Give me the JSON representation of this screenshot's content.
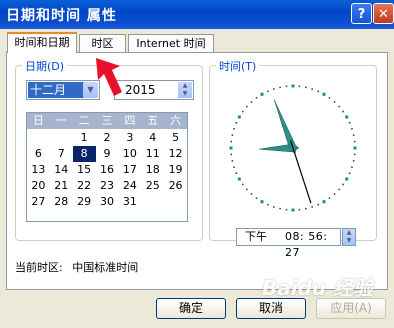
{
  "window": {
    "title": "日期和时间 属性",
    "help_glyph": "?",
    "close_glyph": "✕"
  },
  "tabs": [
    {
      "label": "时间和日期",
      "active": true
    },
    {
      "label": "时区",
      "active": false
    },
    {
      "label": "Internet 时间",
      "active": false
    }
  ],
  "date_group": {
    "label": "日期(D)",
    "month": "十二月",
    "year": "2015",
    "weekdays": [
      "日",
      "一",
      "二",
      "三",
      "四",
      "五",
      "六"
    ],
    "days": [
      "",
      "",
      "1",
      "2",
      "3",
      "4",
      "5",
      "6",
      "7",
      "8",
      "9",
      "10",
      "11",
      "12",
      "13",
      "14",
      "15",
      "16",
      "17",
      "18",
      "19",
      "20",
      "21",
      "22",
      "23",
      "24",
      "25",
      "26",
      "27",
      "28",
      "29",
      "30",
      "31",
      "",
      ""
    ],
    "selected_day": "8"
  },
  "time_group": {
    "label": "时间(T)",
    "ampm": "下午",
    "time": "08: 56: 27",
    "clock": {
      "hour": 8,
      "minute": 56,
      "second": 27
    }
  },
  "timezone": {
    "label": "当前时区:",
    "value": "中国标准时间"
  },
  "buttons": {
    "ok": "确定",
    "cancel": "取消",
    "apply": "应用(A)"
  },
  "colors": {
    "title_bar": "#0b4fd0",
    "selection": "#0a246a",
    "group_label": "#0046d5",
    "clock_hand": "#2e8f87",
    "arrow": "#e8102a"
  },
  "watermark": "Baidu 经验"
}
